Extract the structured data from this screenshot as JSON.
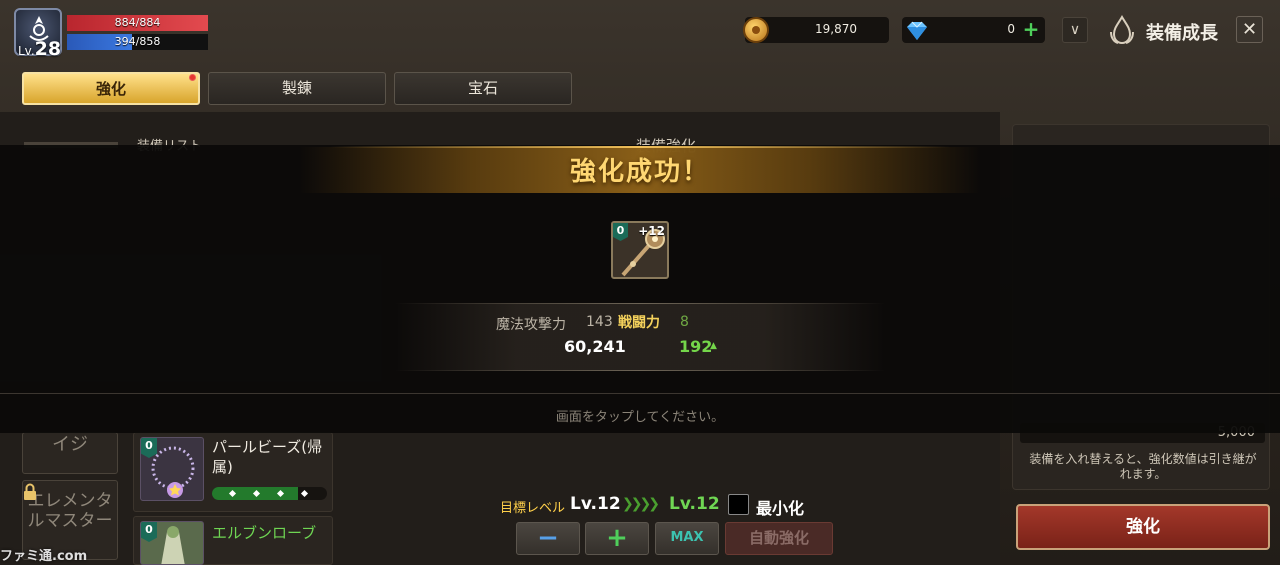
{
  "player": {
    "level_prefix": "Lv.",
    "level": "28",
    "hp": "884/884",
    "mp": "394/858",
    "mp_fill_fraction": 0.46
  },
  "currency": {
    "gold": "19,870",
    "gems": "0",
    "gem_add": "+"
  },
  "header": {
    "dropdown": "∨",
    "title": "装備成長",
    "close": "✕"
  },
  "tabs": [
    {
      "label": "強化",
      "active": true,
      "notification": true
    },
    {
      "label": "製錬",
      "active": false
    },
    {
      "label": "宝石",
      "active": false
    }
  ],
  "background": {
    "equip_list_title": "装備リスト",
    "equip_enhance_title": "装備強化",
    "categories": [
      "イジ",
      "エレメンタルマスター"
    ],
    "items": [
      {
        "badge": "0",
        "name": "パールビーズ(帰属)",
        "progress_filled": 3,
        "progress_total": 4
      },
      {
        "badge": "0",
        "name": "エルブンローブ"
      }
    ],
    "cost_value": "5,000",
    "note": "装備を入れ替えると、強化数値は引き継がれます。",
    "enhance_button": "強化",
    "target": {
      "label": "目標レベル",
      "from": "Lv.12",
      "arrows": "❯❯❯❯",
      "to": "Lv.12"
    },
    "minimize_label": "最小化",
    "controls": {
      "minus": "−",
      "plus": "+",
      "max": "MAX",
      "auto": "自動強化"
    }
  },
  "popup": {
    "banner": "強化成功！",
    "item": {
      "badge": "0",
      "enhance": "+12"
    },
    "stat1_label": "魔法攻撃力",
    "stat1_value": "143",
    "stat2_label": "戦闘力",
    "stat2_value": "8",
    "total1": "60,241",
    "total2": "192",
    "up_arrow": "▲",
    "hint": "画面をタップしてください。"
  },
  "watermark": "ファミ通.com",
  "colors": {
    "gold_text": "#ffd772",
    "green_up": "#74d64a",
    "enhance_red": "#a4382a"
  }
}
